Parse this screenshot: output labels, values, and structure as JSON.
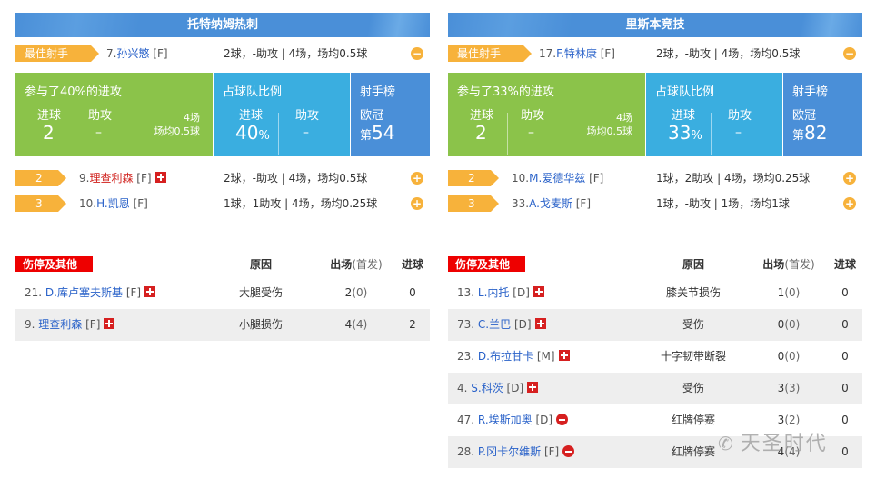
{
  "teams": [
    {
      "name": "托特纳姆热刺",
      "best_label": "最佳射手",
      "top_scorer": {
        "num": "7.",
        "name": "孙兴慜",
        "pos": "[F]",
        "stat": "2球，-助攻 | 4场，场均0.5球",
        "toggle": "−"
      },
      "stats": {
        "involvement": "参与了40%的进攻",
        "goals_label": "进球",
        "goals": "2",
        "assists_label": "助攻",
        "assists": "–",
        "games": "4场",
        "avg": "场均0.5球",
        "share_title": "占球队比例",
        "share_goals_label": "进球",
        "share_goals": "40",
        "share_unit": "%",
        "share_assists_label": "助攻",
        "share_assists": "–",
        "rank_title": "射手榜",
        "rank_comp": "欧冠",
        "rank_prefix": "第",
        "rank": "54"
      },
      "others": [
        {
          "rank": "2",
          "num": "9.",
          "name": "理查利森",
          "pos": "[F]",
          "injured": true,
          "red": true,
          "stat": "2球，-助攻 | 4场，场均0.5球",
          "toggle": "+"
        },
        {
          "rank": "3",
          "num": "10.",
          "name": "H.凯恩",
          "pos": "[F]",
          "injured": false,
          "red": false,
          "stat": "1球，1助攻 | 4场，场均0.25球",
          "toggle": "+"
        }
      ],
      "injury_header": {
        "label": "伤停及其他",
        "reason": "原因",
        "apps": "出场",
        "apps_sub": "(首发)",
        "goals": "进球"
      },
      "injuries": [
        {
          "num": "21.",
          "name": "D.库卢塞夫斯基",
          "pos": "[F]",
          "icon": "injury",
          "reason": "大腿受伤",
          "apps": "2",
          "starts": "(0)",
          "goals": "0"
        },
        {
          "num": "9.",
          "name": "理查利森",
          "pos": "[F]",
          "icon": "injury",
          "reason": "小腿损伤",
          "apps": "4",
          "starts": "(4)",
          "goals": "2"
        }
      ]
    },
    {
      "name": "里斯本竞技",
      "best_label": "最佳射手",
      "top_scorer": {
        "num": "17.",
        "name": "F.特林康",
        "pos": "[F]",
        "stat": "2球，-助攻 | 4场，场均0.5球",
        "toggle": "−"
      },
      "stats": {
        "involvement": "参与了33%的进攻",
        "goals_label": "进球",
        "goals": "2",
        "assists_label": "助攻",
        "assists": "–",
        "games": "4场",
        "avg": "场均0.5球",
        "share_title": "占球队比例",
        "share_goals_label": "进球",
        "share_goals": "33",
        "share_unit": "%",
        "share_assists_label": "助攻",
        "share_assists": "–",
        "rank_title": "射手榜",
        "rank_comp": "欧冠",
        "rank_prefix": "第",
        "rank": "82"
      },
      "others": [
        {
          "rank": "2",
          "num": "10.",
          "name": "M.爱德华兹",
          "pos": "[F]",
          "injured": false,
          "red": false,
          "stat": "1球，2助攻 | 4场，场均0.25球",
          "toggle": "+"
        },
        {
          "rank": "3",
          "num": "33.",
          "name": "A.戈麦斯",
          "pos": "[F]",
          "injured": false,
          "red": false,
          "stat": "1球，-助攻 | 1场，场均1球",
          "toggle": "+"
        }
      ],
      "injury_header": {
        "label": "伤停及其他",
        "reason": "原因",
        "apps": "出场",
        "apps_sub": "(首发)",
        "goals": "进球"
      },
      "injuries": [
        {
          "num": "13.",
          "name": "L.内托",
          "pos": "[D]",
          "icon": "injury",
          "reason": "膝关节损伤",
          "apps": "1",
          "starts": "(0)",
          "goals": "0"
        },
        {
          "num": "73.",
          "name": "C.兰巴",
          "pos": "[D]",
          "icon": "injury",
          "reason": "受伤",
          "apps": "0",
          "starts": "(0)",
          "goals": "0"
        },
        {
          "num": "23.",
          "name": "D.布拉甘卡",
          "pos": "[M]",
          "icon": "injury",
          "reason": "十字韧带断裂",
          "apps": "0",
          "starts": "(0)",
          "goals": "0"
        },
        {
          "num": "4.",
          "name": "S.科茨",
          "pos": "[D]",
          "icon": "injury",
          "reason": "受伤",
          "apps": "3",
          "starts": "(3)",
          "goals": "0"
        },
        {
          "num": "47.",
          "name": "R.埃斯加奥",
          "pos": "[D]",
          "icon": "suspended",
          "reason": "红牌停赛",
          "apps": "3",
          "starts": "(2)",
          "goals": "0"
        },
        {
          "num": "28.",
          "name": "P.冈卡尔维斯",
          "pos": "[F]",
          "icon": "suspended",
          "reason": "红牌停赛",
          "apps": "4",
          "starts": "(4)",
          "goals": "0"
        }
      ]
    }
  ],
  "watermark": "天圣时代"
}
